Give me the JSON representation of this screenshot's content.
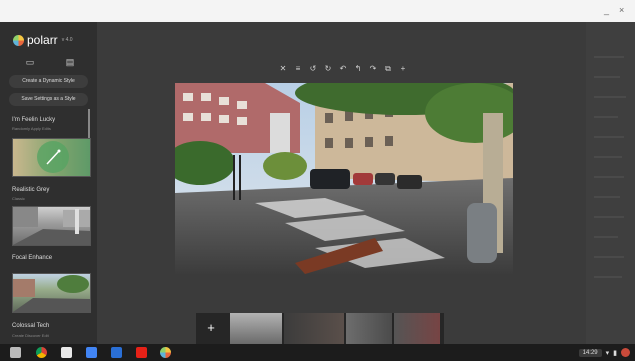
{
  "window": {
    "minimize": "_",
    "close": "×"
  },
  "sidebar": {
    "brand": "polarr",
    "version": "v 4.0",
    "create_button": "Create a Dynamic Style",
    "save_button": "Save Settings as a Style",
    "styles": [
      {
        "name": "I'm Feelin Lucky",
        "sub": "Randomly Apply Edits"
      },
      {
        "name": "Realistic Grey",
        "sub": "Classic"
      },
      {
        "name": "Focal Enhance",
        "sub": ""
      },
      {
        "name": "Colossal Tech",
        "sub": ""
      }
    ],
    "tabs_line": "Create   Discover   Edit"
  },
  "toolbar": {
    "icons": [
      "crop-icon",
      "grid-icon",
      "rotate-left-icon",
      "rotate-right-icon",
      "undo-icon",
      "undo-all-icon",
      "redo-icon",
      "compare-icon",
      "zoom-icon"
    ]
  },
  "filmstrip": {
    "add": "+"
  },
  "tray": {
    "time": "14:29"
  },
  "colors": {
    "accent_green": "#8fd16b",
    "background": "#3b3b3b"
  }
}
